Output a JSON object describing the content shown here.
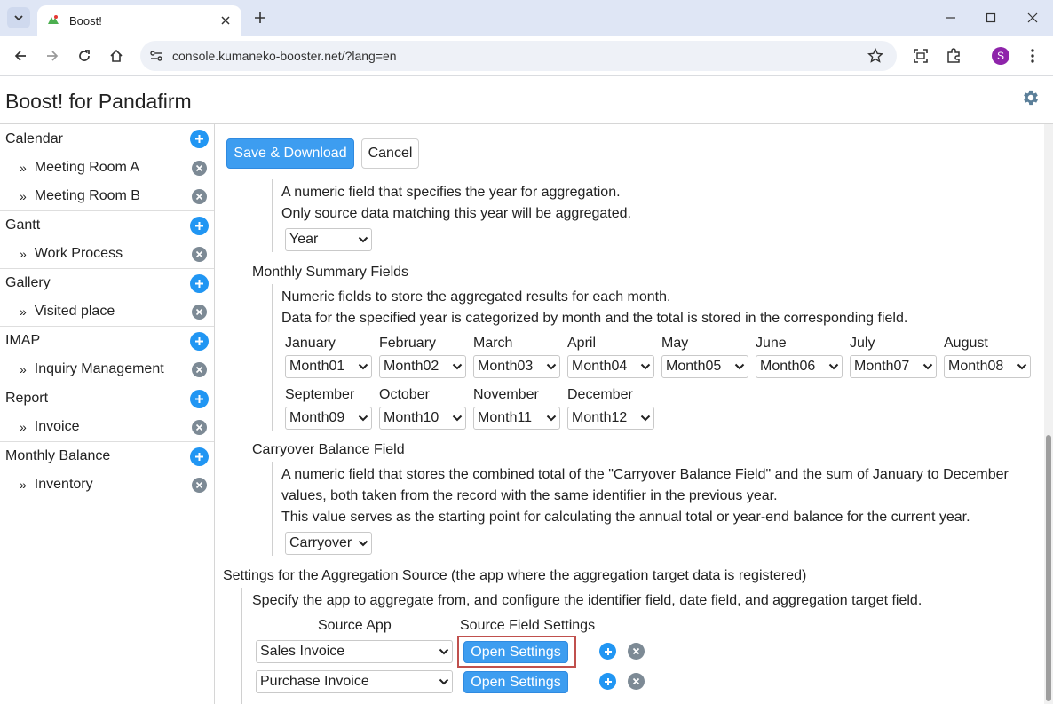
{
  "browser": {
    "tab_title": "Boost!",
    "url": "console.kumaneko-booster.net/?lang=en",
    "profile_initial": "S"
  },
  "app": {
    "title": "Boost! for Pandafirm"
  },
  "sidebar": {
    "groups": [
      {
        "label": "Calendar",
        "items": [
          "Meeting Room A",
          "Meeting Room B"
        ]
      },
      {
        "label": "Gantt",
        "items": [
          "Work Process"
        ]
      },
      {
        "label": "Gallery",
        "items": [
          "Visited place"
        ]
      },
      {
        "label": "IMAP",
        "items": [
          "Inquiry Management"
        ]
      },
      {
        "label": "Report",
        "items": [
          "Invoice"
        ]
      },
      {
        "label": "Monthly Balance",
        "items": [
          "Inventory"
        ]
      }
    ],
    "bullet": "»"
  },
  "actions": {
    "save_label": "Save & Download",
    "cancel_label": "Cancel"
  },
  "year_field": {
    "desc1": "A numeric field that specifies the year for aggregation.",
    "desc2": "Only source data matching this year will be aggregated.",
    "value": "Year"
  },
  "monthly": {
    "heading": "Monthly Summary Fields",
    "desc1": "Numeric fields to store the aggregated results for each month.",
    "desc2": "Data for the specified year is categorized by month and the total is stored in the corresponding field.",
    "months": [
      {
        "label": "January",
        "value": "Month01"
      },
      {
        "label": "February",
        "value": "Month02"
      },
      {
        "label": "March",
        "value": "Month03"
      },
      {
        "label": "April",
        "value": "Month04"
      },
      {
        "label": "May",
        "value": "Month05"
      },
      {
        "label": "June",
        "value": "Month06"
      },
      {
        "label": "July",
        "value": "Month07"
      },
      {
        "label": "August",
        "value": "Month08"
      },
      {
        "label": "September",
        "value": "Month09"
      },
      {
        "label": "October",
        "value": "Month10"
      },
      {
        "label": "November",
        "value": "Month11"
      },
      {
        "label": "December",
        "value": "Month12"
      }
    ]
  },
  "carryover": {
    "heading": "Carryover Balance Field",
    "desc1": "A numeric field that stores the combined total of the \"Carryover Balance Field\" and the sum of January to December",
    "desc2": "values, both taken from the record with the same identifier in the previous year.",
    "desc3": "This value serves as the starting point for calculating the annual total or year-end balance for the current year.",
    "value": "Carryover"
  },
  "source": {
    "heading": "Settings for the Aggregation Source (the app where the aggregation target data is registered)",
    "desc": "Specify the app to aggregate from, and configure the identifier field, date field, and aggregation target field.",
    "col_app": "Source App",
    "col_settings": "Source Field Settings",
    "rows": [
      {
        "app": "Sales Invoice",
        "button": "Open Settings"
      },
      {
        "app": "Purchase Invoice",
        "button": "Open Settings"
      }
    ]
  }
}
